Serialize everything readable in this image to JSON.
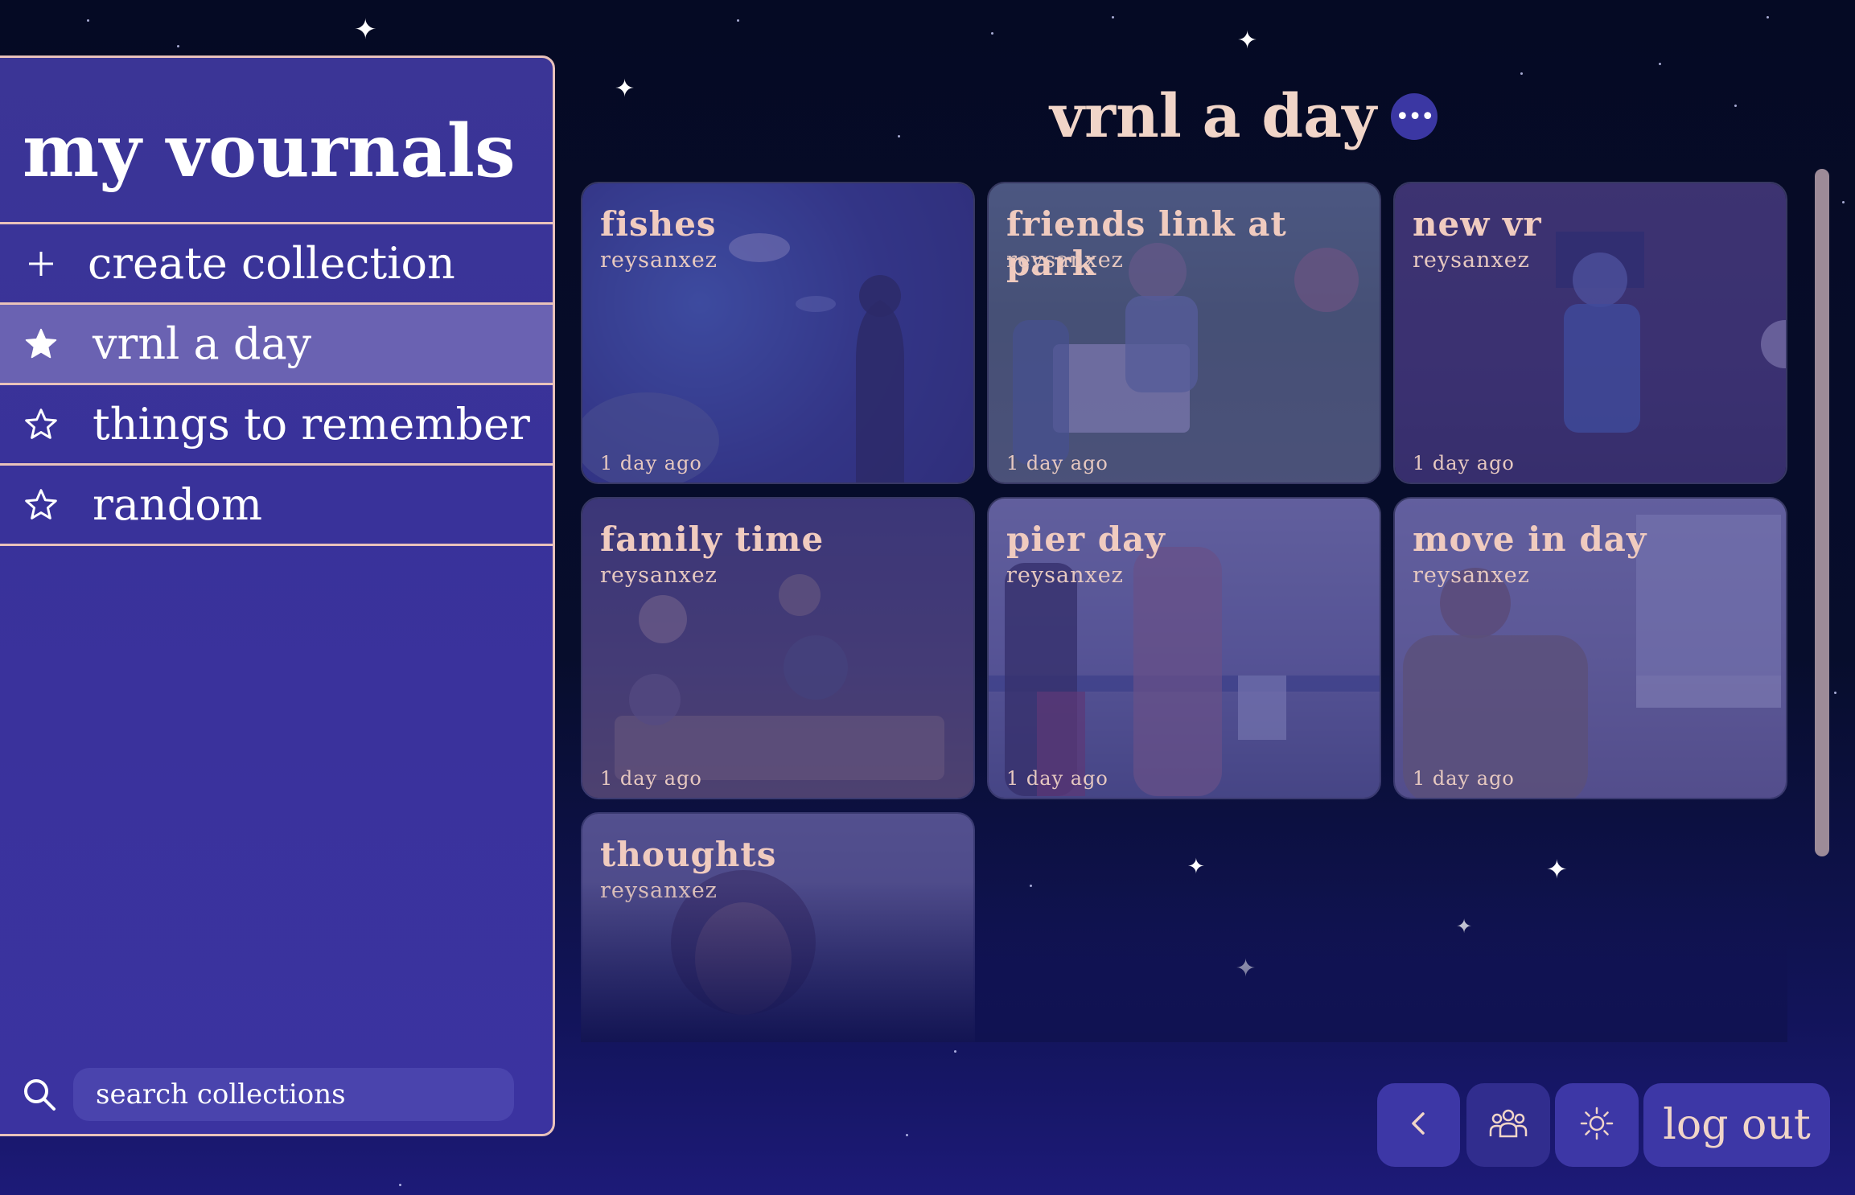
{
  "sidebar": {
    "title": "my vournals",
    "create_label": "create collection",
    "items": [
      {
        "label": "vrnl a day",
        "icon": "star-filled-icon",
        "active": true
      },
      {
        "label": "things to remember",
        "icon": "star-outline-icon",
        "active": false
      },
      {
        "label": "random",
        "icon": "star-outline-icon",
        "active": false
      }
    ],
    "search_placeholder": "search collections"
  },
  "header": {
    "title": "vrnl a day",
    "more_icon": "ellipsis-icon"
  },
  "entries": [
    {
      "title": "fishes",
      "author": "reysanxez",
      "time": "1 day ago"
    },
    {
      "title": "friends link at park",
      "author": "reysanxez",
      "time": "1 day ago"
    },
    {
      "title": "new vr",
      "author": "reysanxez",
      "time": "1 day ago"
    },
    {
      "title": "family time",
      "author": "reysanxez",
      "time": "1 day ago"
    },
    {
      "title": "pier day",
      "author": "reysanxez",
      "time": "1 day ago"
    },
    {
      "title": "move in day",
      "author": "reysanxez",
      "time": "1 day ago"
    },
    {
      "title": "thoughts",
      "author": "reysanxez",
      "time": ""
    }
  ],
  "bottom_bar": {
    "back_icon": "chevron-left-icon",
    "friends_icon": "people-group-icon",
    "theme_icon": "sun-icon",
    "logout_label": "log out"
  },
  "colors": {
    "accent_text": "#f1d5c8",
    "border": "#e9c2bb",
    "panel": "#3b3596",
    "button": "#3d37a6"
  }
}
